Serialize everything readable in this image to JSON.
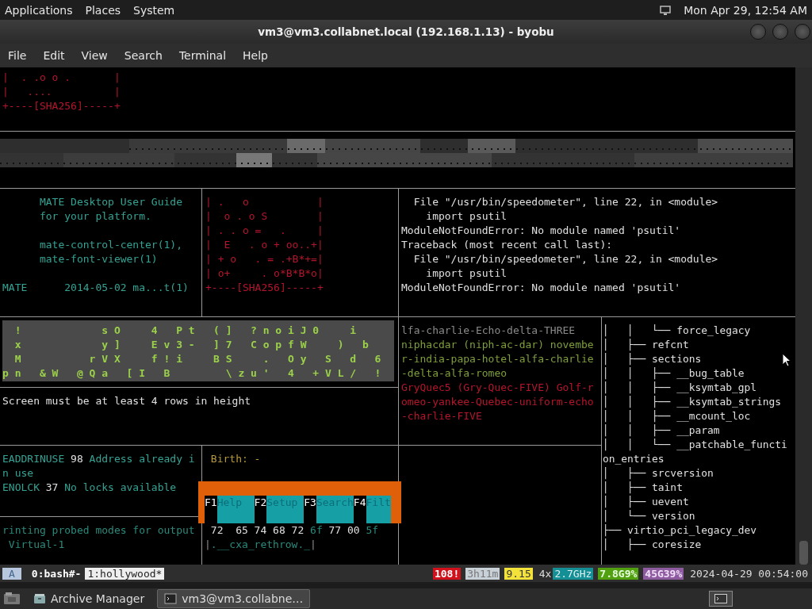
{
  "top_panel": {
    "menus": [
      "Applications",
      "Places",
      "System"
    ],
    "clock": "Mon Apr 29, 12:54 AM"
  },
  "window": {
    "title": "vm3@vm3.collabnet.local (192.168.1.13) - byobu"
  },
  "menu_bar": [
    "File",
    "Edit",
    "View",
    "Search",
    "Terminal",
    "Help"
  ],
  "panes": {
    "fingerprint_top": {
      "kind": "alert",
      "blocks": [
        [
          "|  . .o o .       |",
          "|   ....          |",
          "+----[SHA256]-----+"
        ]
      ]
    },
    "man_page": {
      "kind": "accent",
      "blocks": [
        [
          "      MATE Desktop User Guide",
          "      for your platform."
        ],
        [
          "      mate-control-center(1),",
          "      mate-font-viewer(1)"
        ],
        [
          "MATE      2014-05-02 ma...t(1)"
        ]
      ]
    },
    "fingerprint": {
      "kind": "alert",
      "blocks": [
        [
          "| .   o           |",
          "|  o . o S        |",
          "| . . o =   .     |",
          "|  E   . o + oo..+|",
          "| + o   . = .+B*+=|",
          "| o+     . o*B*B*o|",
          "+----[SHA256]-----+"
        ]
      ]
    },
    "traceback": {
      "kind": "plain",
      "blocks": [
        [
          "  File \"/usr/bin/speedometer\", line 22, in <module>",
          "    import psutil",
          "ModuleNotFoundError: No module named 'psutil'",
          "Traceback (most recent call last):",
          "  File \"/usr/bin/speedometer\", line 22, in <module>",
          "    import psutil",
          "ModuleNotFoundError: No module named 'psutil'"
        ]
      ]
    },
    "matrix": {
      "kind": "matrix",
      "blocks": [
        [
          "  !             s O     4   P t   ( ]   ? n o i J 0     i",
          "  x             y ]     E v 3 -   ] 7   C o p f W     )   b",
          "  M           r V X     f ! i     B S     .   O y   S   d   6",
          "p n   & W   @ Q a   [ I   B         \\ z u '   4   + V L /   !"
        ]
      ]
    },
    "screen_message": {
      "kind": "plain",
      "blocks": [
        [
          "Screen must be at least 4 rows in height"
        ]
      ]
    },
    "callsigns": {
      "kind": "pass",
      "blocks": [
        [
          [
            {
              "text": "lfa-charlie-Echo-delta-THREE",
              "kind": "muted"
            }
          ],
          "niphacdar (niph-ac-dar) novembe",
          "r-india-papa-hotel-alfa-charlie",
          "-delta-alfa-romeo",
          [
            {
              "text": "GryQuec5 (Gry-Quec-FIVE) Golf-r",
              "kind": "alert"
            }
          ],
          [
            {
              "text": "omeo-yankee-Quebec-uniform-echo",
              "kind": "alert"
            }
          ],
          [
            {
              "text": "-charlie-FIVE",
              "kind": "alert"
            }
          ]
        ]
      ]
    },
    "errno": {
      "kind": "accent",
      "blocks": [
        [
          [
            {
              "text": "EADDRINUSE",
              "kind": "accent"
            },
            {
              "text": " 98 ",
              "kind": "plain"
            },
            {
              "text": "Address already i",
              "kind": "accent"
            }
          ],
          "n use",
          [
            {
              "text": "ENOLCK",
              "kind": "accent"
            },
            {
              "text": " 37 ",
              "kind": "plain"
            },
            {
              "text": "No locks available",
              "kind": "accent"
            }
          ]
        ]
      ]
    },
    "stat": {
      "kind": "notice",
      "blocks": [
        [
          " Birth: -"
        ]
      ]
    },
    "xrandr": {
      "kind": "dim",
      "blocks": [
        [
          "rinting probed modes for output",
          " Virtual-1"
        ]
      ]
    },
    "hexdump": {
      "blocks": [
        [
          [
            {
              "text": " 72  65 74 68 72 ",
              "kind": "plain"
            },
            {
              "text": "6f",
              "kind": "dim"
            },
            {
              "text": " 77 00 ",
              "kind": "plain"
            },
            {
              "text": "5f",
              "kind": "dim"
            }
          ],
          [
            {
              "text": "|",
              "kind": "muted"
            },
            {
              "text": ".__cxa_rethrow._",
              "kind": "dim"
            },
            {
              "text": "|",
              "kind": "muted"
            }
          ]
        ]
      ]
    },
    "module_tree": {
      "kind": "plain",
      "blocks": [
        [
          "│   │   └── force_legacy",
          "│   ├── refcnt",
          "│   ├── sections",
          "│   │   ├── __bug_table",
          "│   │   ├── __ksymtab_gpl",
          "│   │   ├── __ksymtab_strings",
          "│   │   ├── __mcount_loc",
          "│   │   ├── __param",
          "│   │   └── __patchable_functi",
          "on_entries",
          "│   ├── srcversion",
          "│   ├── taint",
          "│   ├── uevent",
          "│   └── version",
          "├── virtio_pci_legacy_dev",
          "│   ├── coresize"
        ]
      ]
    }
  },
  "help_popup": {
    "keys": [
      {
        "key": "F1",
        "label": "Help"
      },
      {
        "key": "F2",
        "label": "Setup"
      },
      {
        "key": "F3",
        "label": "Search"
      },
      {
        "key": "F4",
        "label": "Filt"
      }
    ]
  },
  "status_bar": {
    "session": "A",
    "windows": [
      {
        "label": "0:bash#-",
        "selected": false
      },
      {
        "label": "1:hollywood*",
        "selected": true
      }
    ],
    "stats": [
      {
        "text": "108!",
        "kind": "alert"
      },
      {
        "text": "3h11m",
        "kind": "uptime"
      },
      {
        "text": "9.15",
        "kind": "load"
      },
      {
        "text": "4x",
        "kind": "plain"
      },
      {
        "text": "2.7GHz",
        "kind": "cpu"
      },
      {
        "text": "7.8G9%",
        "kind": "memory"
      },
      {
        "text": "45G39%",
        "kind": "disk"
      },
      {
        "text": "2024-04-29 00:54:00",
        "kind": "plain"
      }
    ]
  },
  "taskbar": {
    "tasks": [
      {
        "label": "Archive Manager",
        "selected": false
      },
      {
        "label": "vm3@vm3.collabne…",
        "selected": true
      }
    ]
  }
}
